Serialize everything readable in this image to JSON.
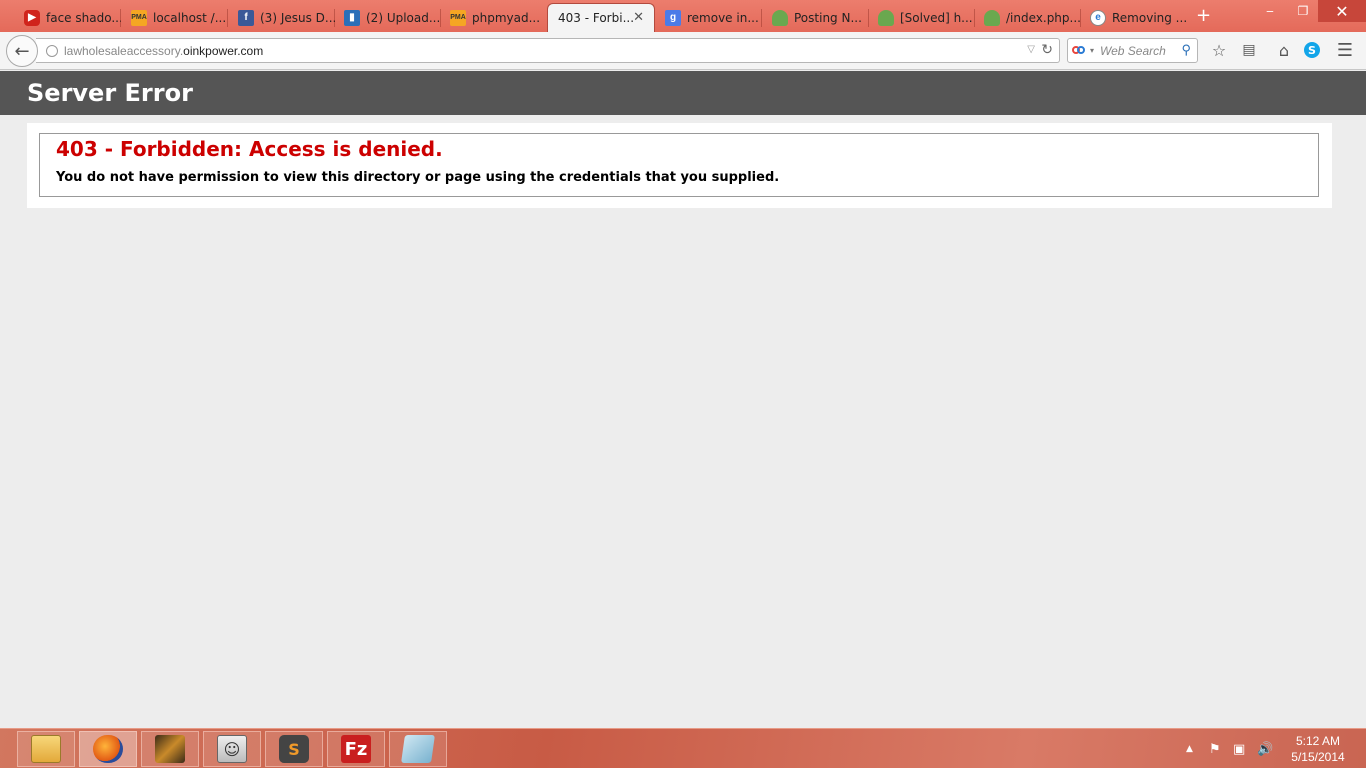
{
  "browser": {
    "tabs": [
      {
        "label": "face shado...",
        "icon": "youtube-icon"
      },
      {
        "label": "localhost /...",
        "icon": "phpmyadmin-icon"
      },
      {
        "label": "(3) Jesus D...",
        "icon": "facebook-icon"
      },
      {
        "label": "(2) Upload...",
        "icon": "trello-icon"
      },
      {
        "label": "phpmyad...",
        "icon": "phpmyadmin-icon"
      },
      {
        "label": "403 - Forbi...",
        "icon": "none",
        "active": true
      },
      {
        "label": "remove in...",
        "icon": "google-icon"
      },
      {
        "label": "Posting N...",
        "icon": "forum-icon"
      },
      {
        "label": "[Solved] h...",
        "icon": "forum-icon"
      },
      {
        "label": "/index.php...",
        "icon": "forum-icon"
      },
      {
        "label": "Removing ...",
        "icon": "ie-icon"
      }
    ],
    "new_tab_glyph": "+",
    "url": {
      "subdomain": "lawholesaleaccessory.",
      "domain": "oinkpower.com"
    },
    "search_placeholder": "Web Search"
  },
  "page": {
    "header_title": "Server Error",
    "error_title": "403 - Forbidden: Access is denied.",
    "error_message": "You do not have permission to view this directory or page using the credentials that you supplied.",
    "header_bg": "#555555",
    "error_color": "#cc0000"
  },
  "taskbar": {
    "apps": [
      {
        "name": "file-explorer-icon",
        "active": false
      },
      {
        "name": "firefox-icon",
        "active": true
      },
      {
        "name": "game-icon",
        "active": false
      },
      {
        "name": "anime-app-icon",
        "active": false
      },
      {
        "name": "sublime-text-icon",
        "active": false
      },
      {
        "name": "filezilla-icon",
        "active": false
      },
      {
        "name": "notepad-icon",
        "active": false
      }
    ],
    "clock": {
      "time": "5:12 AM",
      "date": "5/15/2014"
    }
  }
}
